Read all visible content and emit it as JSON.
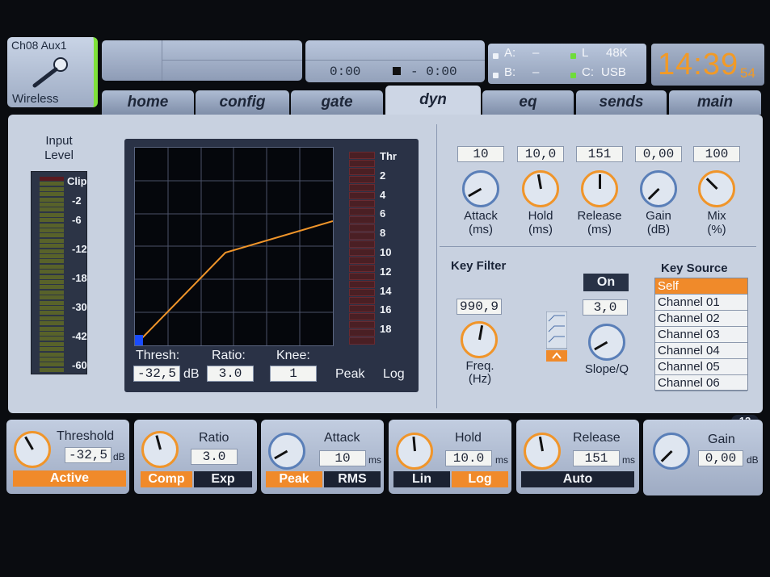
{
  "channel": {
    "name": "Ch08 Aux1",
    "source": "Wireless"
  },
  "transport": {
    "time_elapsed": "0:00",
    "time_remaining": "- 0:00"
  },
  "status": {
    "a_label": "A:",
    "a_value": "–",
    "b_label": "B:",
    "b_value": "–",
    "l_label": "L",
    "rate": "48K",
    "c_label": "C:",
    "card": "USB"
  },
  "clock": {
    "hm": "14:39",
    "sec": "54"
  },
  "tabs": [
    "home",
    "config",
    "gate",
    "dyn",
    "eq",
    "sends",
    "main"
  ],
  "input": {
    "label_1": "Input",
    "label_2": "Level",
    "scale": [
      "Clip",
      "-2",
      "-6",
      "-12",
      "-18",
      "-30",
      "-42",
      "-60"
    ]
  },
  "graph": {
    "ladder": [
      "Thr",
      "2",
      "4",
      "6",
      "8",
      "10",
      "12",
      "14",
      "16",
      "18"
    ],
    "thresh_label": "Thresh:",
    "thresh_value": "-32,5",
    "thresh_unit": "dB",
    "ratio_label": "Ratio:",
    "ratio_value": "3.0",
    "knee_label": "Knee:",
    "knee_value": "1",
    "peak": "Peak",
    "log": "Log"
  },
  "params": [
    {
      "value": "10",
      "label": "Attack",
      "unit": "(ms)"
    },
    {
      "value": "10,0",
      "label": "Hold",
      "unit": "(ms)"
    },
    {
      "value": "151",
      "label": "Release",
      "unit": "(ms)"
    },
    {
      "value": "0,00",
      "label": "Gain",
      "unit": "(dB)"
    },
    {
      "value": "100",
      "label": "Mix",
      "unit": "(%)"
    }
  ],
  "key_filter": {
    "title": "Key Filter",
    "freq_value": "990,9",
    "freq_label": "Freq.",
    "freq_unit": "(Hz)",
    "on_label": "On",
    "slope_value": "3,0",
    "slope_label": "Slope/Q"
  },
  "key_source": {
    "title": "Key Source",
    "items": [
      "Self",
      "Channel 01",
      "Channel 02",
      "Channel 03",
      "Channel 04",
      "Channel 05",
      "Channel 06"
    ],
    "selected": "Self"
  },
  "bottom": {
    "page_1": "1",
    "page_2": "2",
    "threshold": {
      "title": "Threshold",
      "value": "-32,5",
      "unit": "dB",
      "btn": "Active"
    },
    "ratio": {
      "title": "Ratio",
      "value": "3.0",
      "btn1": "Comp",
      "btn2": "Exp"
    },
    "attack": {
      "title": "Attack",
      "value": "10",
      "unit": "ms",
      "btn1": "Peak",
      "btn2": "RMS"
    },
    "hold": {
      "title": "Hold",
      "value": "10.0",
      "unit": "ms",
      "btn1": "Lin",
      "btn2": "Log"
    },
    "release": {
      "title": "Release",
      "value": "151",
      "unit": "ms",
      "btn": "Auto"
    },
    "gain": {
      "title": "Gain",
      "value": "0,00",
      "unit": "dB"
    }
  },
  "colors": {
    "accent": "#f08a2a",
    "panel": "#c8d1e0",
    "clock": "#f29a26"
  }
}
